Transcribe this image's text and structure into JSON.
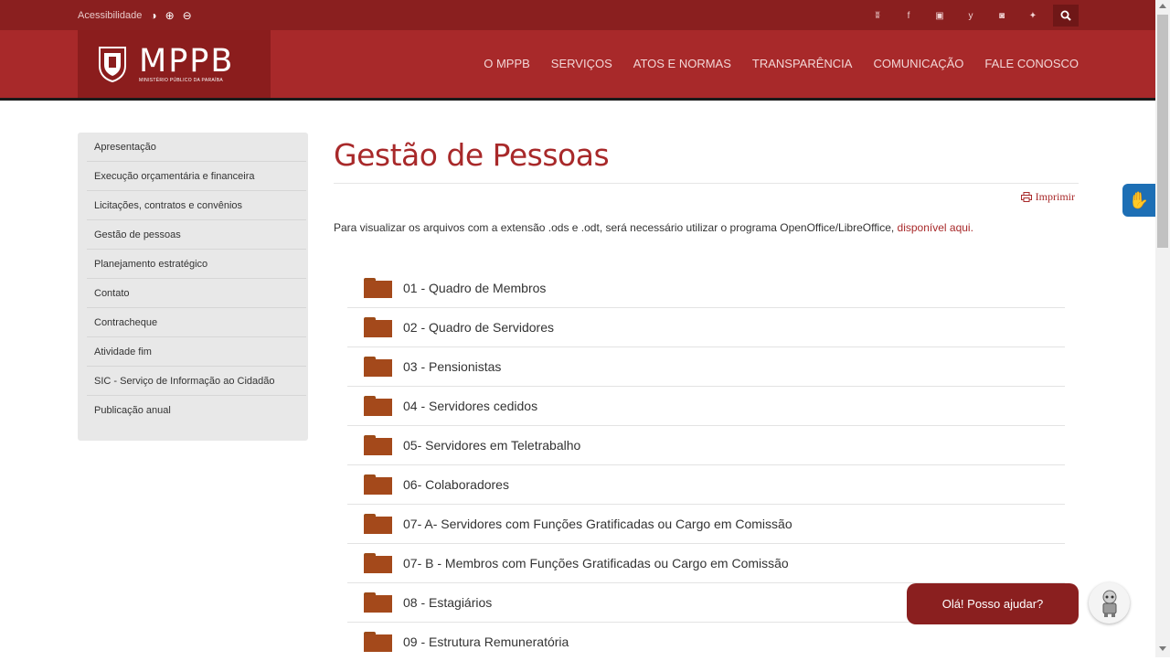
{
  "topbar": {
    "accessibility_label": "Acessibilidade",
    "contrast_icon": "◑",
    "zoom_in_icon": "⊕",
    "zoom_out_icon": "⊖",
    "social_icons": [
      "rss-icon",
      "facebook-icon",
      "youtube-icon",
      "twitter-icon",
      "instagram-icon",
      "android-icon"
    ],
    "social_glyphs": [
      "ʬ",
      "f",
      "▣",
      "y",
      "◙",
      "✦"
    ],
    "search_icon": "search-icon"
  },
  "header": {
    "brand": "MPPB",
    "brand_sub": "MINISTÉRIO PÚBLICO DA PARAÍBA",
    "menu": [
      "O MPPB",
      "SERVIÇOS",
      "ATOS E NORMAS",
      "TRANSPARÊNCIA",
      "COMUNICAÇÃO",
      "FALE CONOSCO"
    ]
  },
  "sidebar": {
    "items": [
      "Apresentação",
      "Execução orçamentária e financeira",
      "Licitações, contratos e convênios",
      "Gestão de pessoas",
      "Planejamento estratégico",
      "Contato",
      "Contracheque",
      "Atividade fim",
      "SIC - Serviço de Informação ao Cidadão",
      "Publicação anual"
    ]
  },
  "main": {
    "title": "Gestão de Pessoas",
    "print_label": "Imprimir",
    "info_text": "Para visualizar os arquivos com a extensão .ods e .odt, será necessário utilizar o programa OpenOffice/LibreOffice, ",
    "info_link": "disponível aqui.",
    "folders": [
      "01 - Quadro de Membros",
      "02 - Quadro de Servidores",
      "03 - Pensionistas",
      "04 - Servidores cedidos",
      "05- Servidores em Teletrabalho",
      "06- Colaboradores",
      "07- A- Servidores com Funções Gratificadas ou Cargo em Comissão",
      "07- B - Membros com Funções Gratificadas ou Cargo em Comissão",
      "08 - Estagiários",
      "09 - Estrutura Remuneratória"
    ]
  },
  "chat": {
    "label": "Olá! Posso ajudar?"
  },
  "colors": {
    "brand_dark": "#8a1f1f",
    "brand": "#a8292a",
    "folder": "#a4491b",
    "vlibras": "#1d6fb5"
  }
}
